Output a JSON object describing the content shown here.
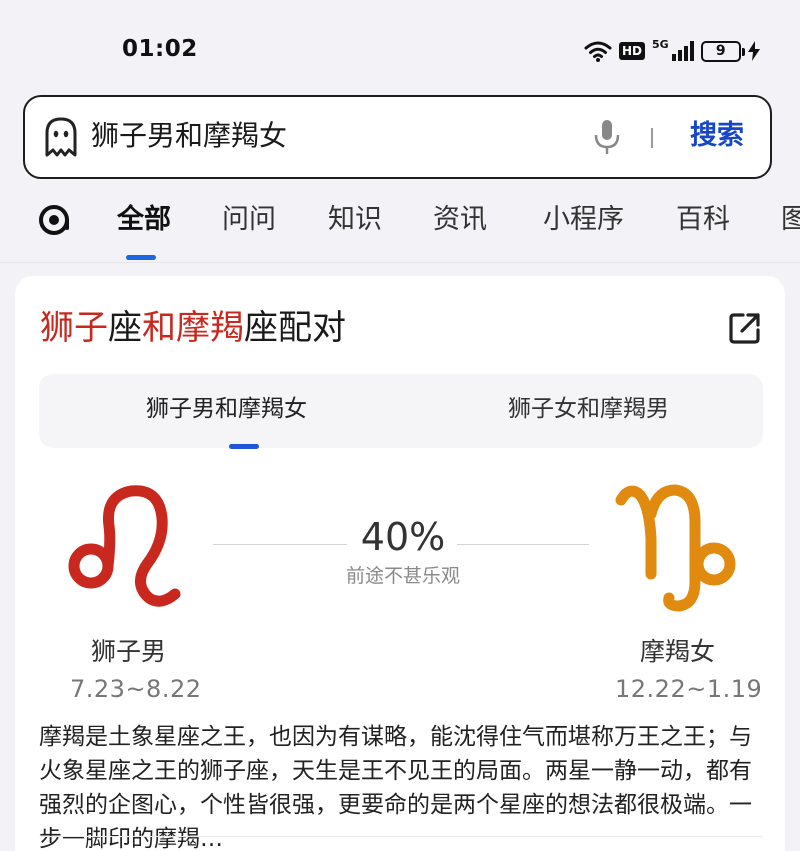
{
  "status_bar": {
    "time": "01:02",
    "hd_label": "HD",
    "network_label": "5G",
    "battery_level": "9"
  },
  "search": {
    "query": "狮子男和摩羯女",
    "button_label": "搜索",
    "icons": [
      "ghost-icon",
      "microphone-icon"
    ]
  },
  "tabs": {
    "items": [
      {
        "label": "全部",
        "active": true
      },
      {
        "label": "问问"
      },
      {
        "label": "知识"
      },
      {
        "label": "资讯"
      },
      {
        "label": "小程序"
      },
      {
        "label": "百科"
      },
      {
        "label": "图"
      }
    ],
    "accent_color": "#1f66e5"
  },
  "card": {
    "title_parts": [
      "狮子",
      "座",
      "和",
      "摩羯",
      "座配对"
    ],
    "highlight_color": "#c8281e",
    "pair_tabs": [
      {
        "label": "狮子男和摩羯女",
        "active": true
      },
      {
        "label": "狮子女和摩羯男"
      }
    ],
    "score": "40%",
    "score_label": "前途不甚乐观",
    "left": {
      "name": "狮子男",
      "date": "7.23~8.22",
      "symbol": "leo-symbol",
      "color": "#c8281e"
    },
    "right": {
      "name": "摩羯女",
      "date": "12.22~1.19",
      "symbol": "capricorn-symbol",
      "color": "#e08a10"
    },
    "description": "摩羯是土象星座之王，也因为有谋略，能沈得住气而堪称万王之王；与火象星座之王的狮子座，天生是王不见王的局面。两星一静一动，都有强烈的企图心，个性皆很强，更要命的是两个星座的想法都很极端。一步一脚印的摩羯…"
  }
}
